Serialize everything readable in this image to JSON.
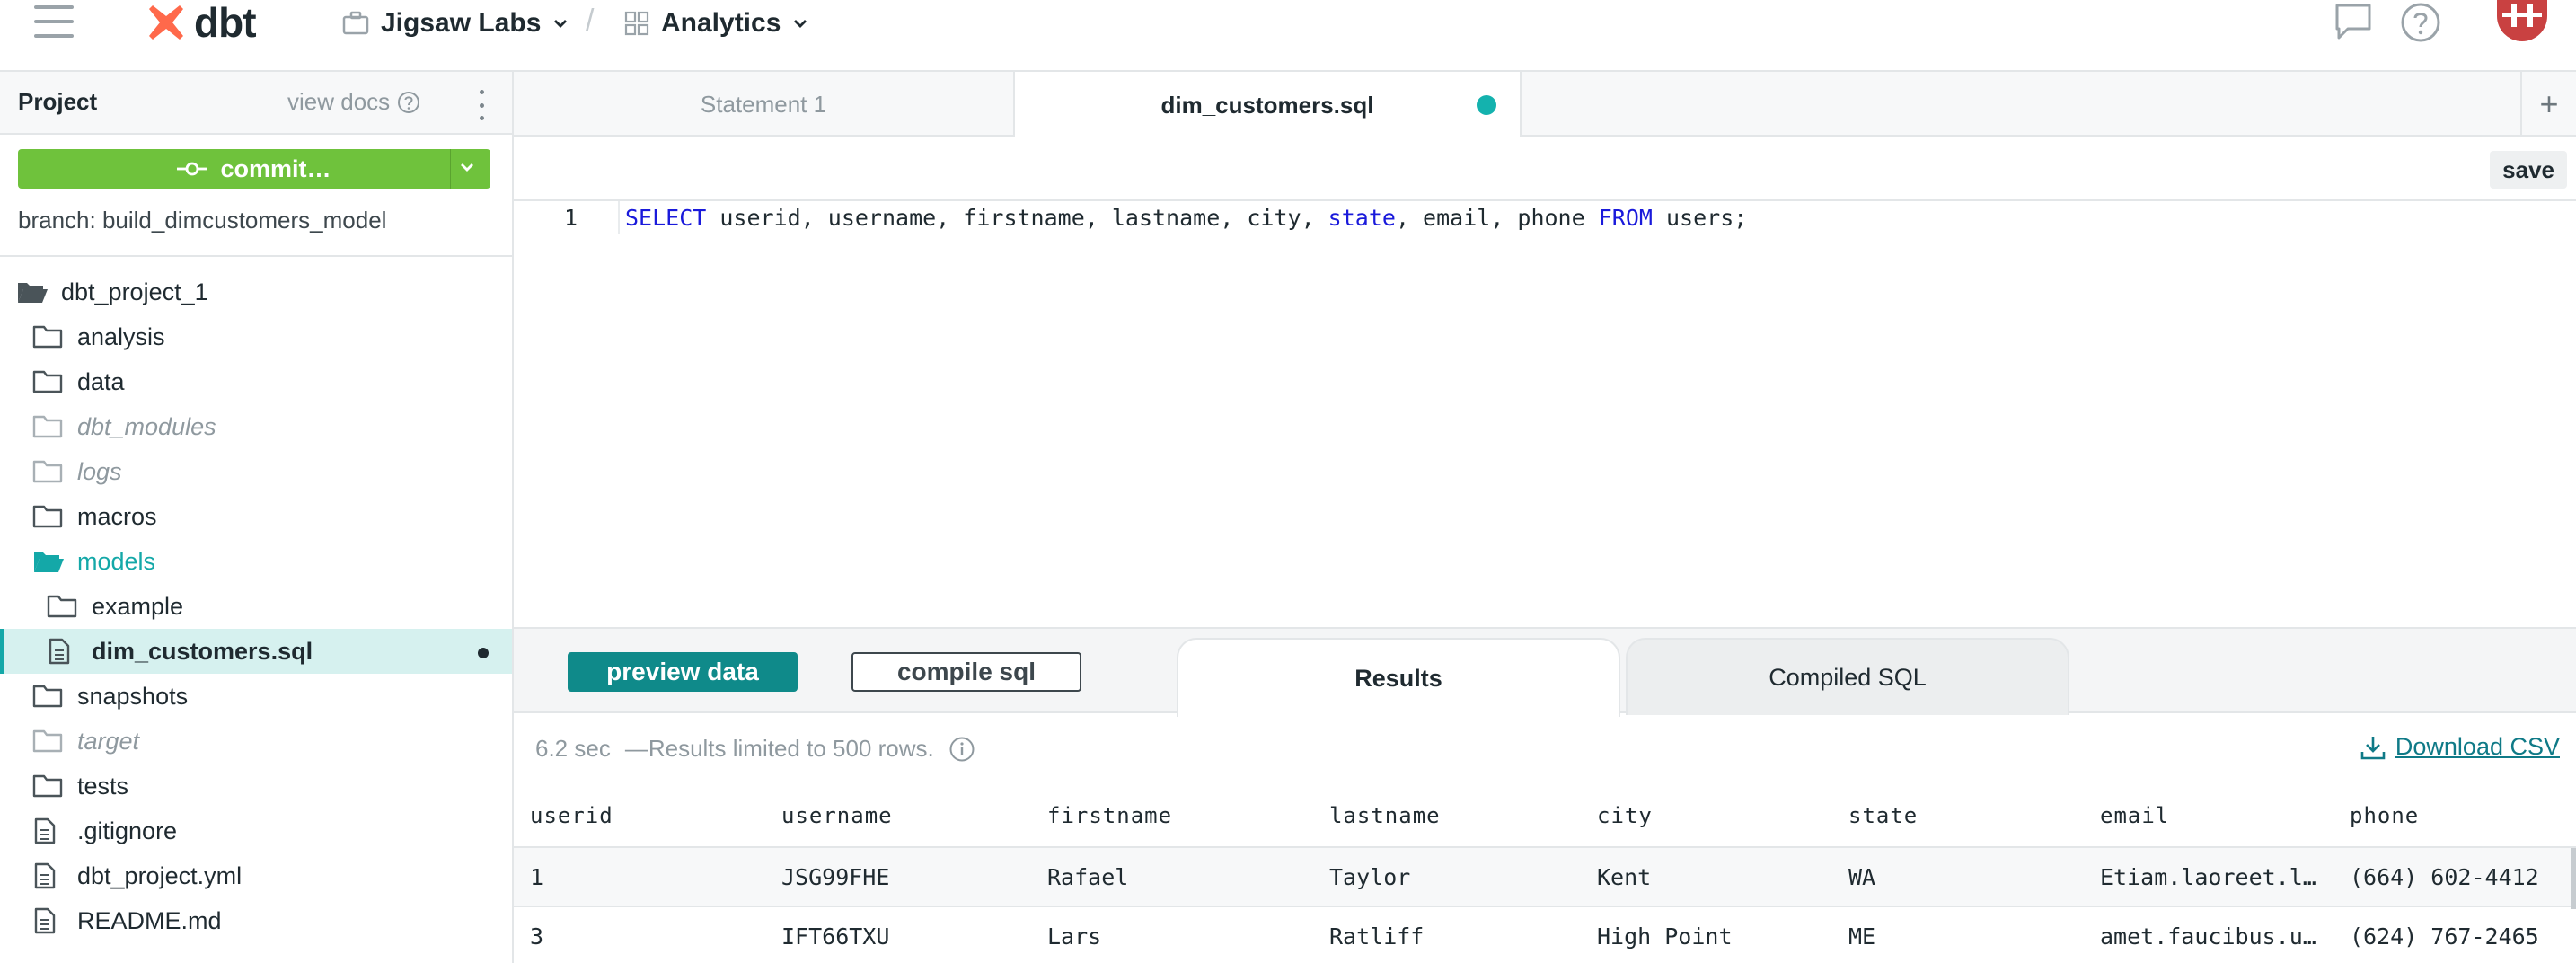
{
  "topbar": {
    "logo_text": "dbt",
    "account": "Jigsaw Labs",
    "crumb_separator": "/",
    "project": "Analytics"
  },
  "sidebar": {
    "title": "Project",
    "view_docs": "view docs",
    "commit_label": "commit…",
    "branch": "branch: build_dimcustomers_model",
    "root": "dbt_project_1",
    "items": [
      {
        "label": "analysis",
        "type": "folder"
      },
      {
        "label": "data",
        "type": "folder"
      },
      {
        "label": "dbt_modules",
        "type": "folder"
      },
      {
        "label": "logs",
        "type": "folder"
      },
      {
        "label": "macros",
        "type": "folder"
      },
      {
        "label": "models",
        "type": "folder"
      },
      {
        "label": "example",
        "type": "folder"
      },
      {
        "label": "dim_customers.sql",
        "type": "file"
      },
      {
        "label": "snapshots",
        "type": "folder"
      },
      {
        "label": "target",
        "type": "folder"
      },
      {
        "label": "tests",
        "type": "folder"
      },
      {
        "label": ".gitignore",
        "type": "file"
      },
      {
        "label": "dbt_project.yml",
        "type": "file"
      },
      {
        "label": "README.md",
        "type": "file"
      }
    ]
  },
  "editor": {
    "tabs": [
      "Statement 1",
      "dim_customers.sql"
    ],
    "active_tab": "dim_customers.sql",
    "save_label": "save",
    "line_number": "1",
    "code": {
      "kw_select": "SELECT",
      "seg1": " userid, username, firstname, lastname, city, ",
      "kw_state": "state",
      "seg2": ", email, phone ",
      "kw_from": "FROM",
      "seg3": " users;"
    }
  },
  "results": {
    "preview_label": "preview data",
    "compile_label": "compile sql",
    "tab_results": "Results",
    "tab_compiled": "Compiled SQL",
    "time": "6.2 sec",
    "limit_note": "—Results limited to 500 rows.",
    "download_label": "Download CSV",
    "columns": [
      "userid",
      "username",
      "firstname",
      "lastname",
      "city",
      "state",
      "email",
      "phone"
    ],
    "rows": [
      [
        "1",
        "JSG99FHE",
        "Rafael",
        "Taylor",
        "Kent",
        "WA",
        "Etiam.laoreet.l…",
        "(664) 602-4412"
      ],
      [
        "3",
        "IFT66TXU",
        "Lars",
        "Ratliff",
        "High Point",
        "ME",
        "amet.faucibus.u…",
        "(624) 767-2465"
      ]
    ]
  },
  "colors": {
    "brand_orange": "#ff694b",
    "teal": "#14a8a8",
    "commit_green": "#6fc23c",
    "preview_teal": "#0f8a8a",
    "sql_keyword": "#1a1adb"
  }
}
